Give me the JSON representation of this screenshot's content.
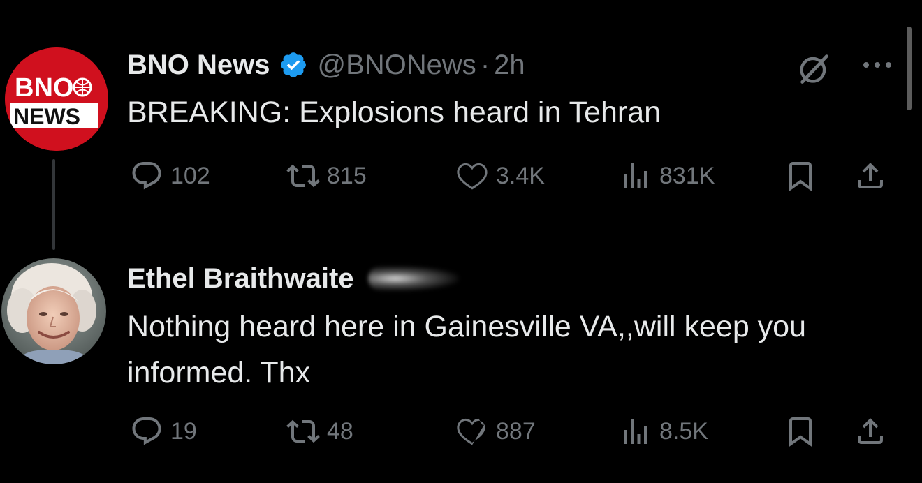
{
  "tweets": [
    {
      "avatar": {
        "icon": "bno-news-logo",
        "logo_line1": "BNO",
        "logo_line2": "NEWS",
        "bg_color": "#d0101e"
      },
      "display_name": "BNO News",
      "verified": true,
      "handle": "@BNONews",
      "separator": "·",
      "time": "2h",
      "text": "BREAKING: Explosions heard in Tehran",
      "stats": {
        "replies": "102",
        "retweets": "815",
        "likes": "3.4K",
        "views": "831K"
      },
      "icons": {
        "grok": "grok-icon",
        "more": "more-icon"
      }
    },
    {
      "avatar": {
        "icon": "profile-photo-elderly-woman"
      },
      "display_name": "Ethel Braithwaite",
      "text": "Nothing heard here in Gainesville VA,,will keep you informed. Thx",
      "stats": {
        "replies": "19",
        "retweets": "48",
        "likes": "887",
        "views": "8.5K"
      }
    }
  ],
  "colors": {
    "background": "#000000",
    "text": "#e7e9ea",
    "muted": "#71767b",
    "verified": "#1d9bf0",
    "bno_red": "#d0101e"
  }
}
